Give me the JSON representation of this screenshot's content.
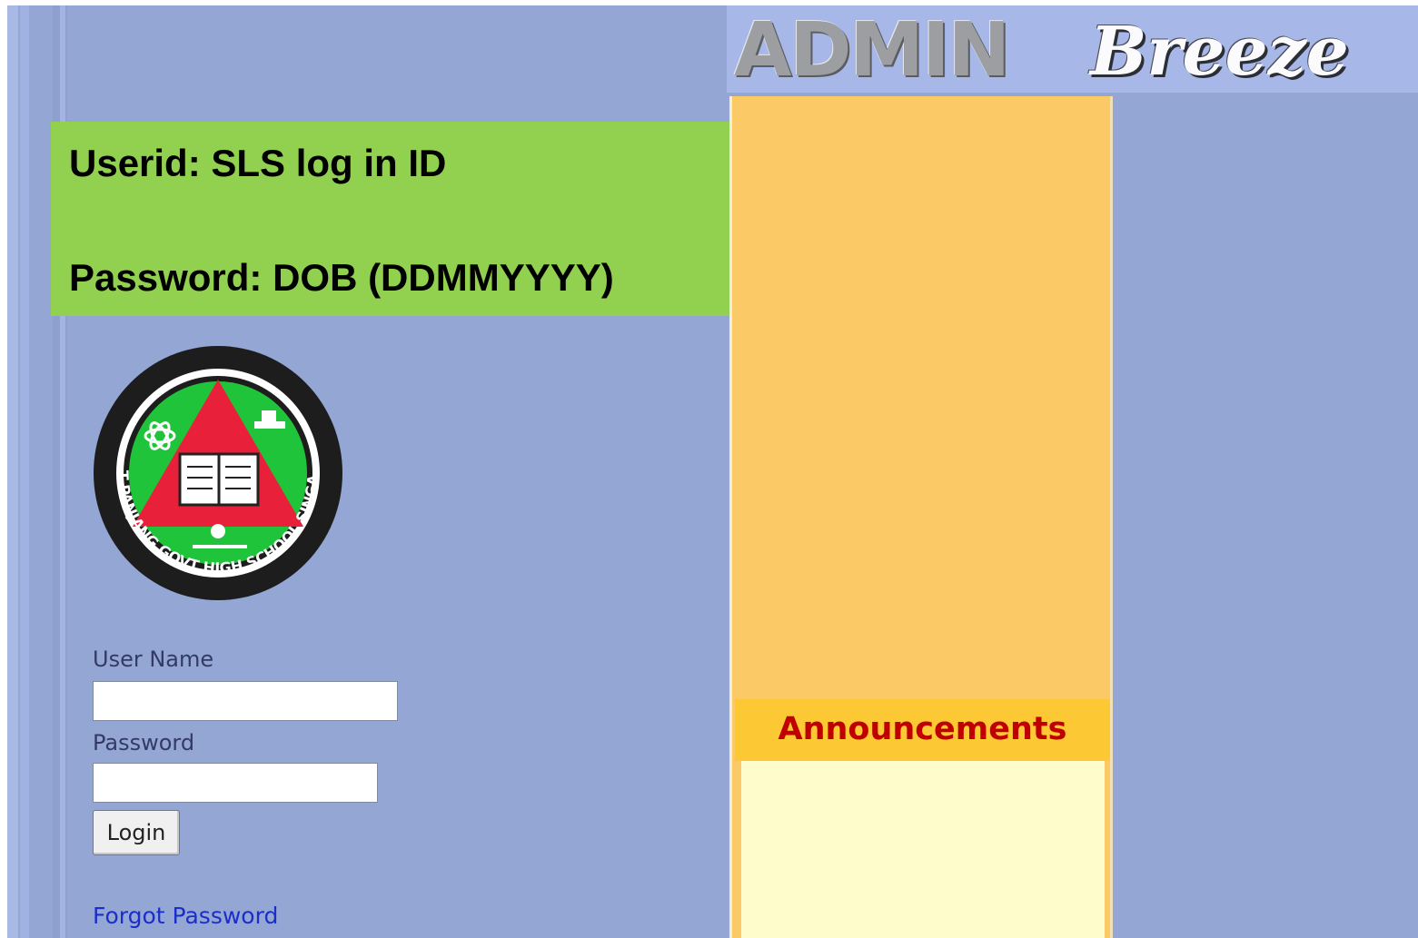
{
  "brand": {
    "admin": "ADMIN",
    "breeze": "Breeze"
  },
  "instructions": {
    "userid_line": "Userid: SLS log in ID",
    "password_line": "Password: DOB (DDMMYYYY)"
  },
  "school_crest": {
    "icon": "school-crest",
    "text": "BUKIT PANJANG GOVT HIGH SCHOOL SINGAPORE"
  },
  "login": {
    "username_label": "User Name",
    "username_value": "",
    "password_label": "Password",
    "password_value": "",
    "login_button": "Login",
    "forgot_password": "Forgot Password"
  },
  "announcements": {
    "title": "Announcements"
  },
  "colors": {
    "page_bg": "#94a6d4",
    "info_box": "#92d050",
    "panel": "#fbc965",
    "announce_header": "#fcc934",
    "announce_title": "#c00000",
    "announce_body": "#fffccb",
    "link": "#1b2fc8"
  }
}
